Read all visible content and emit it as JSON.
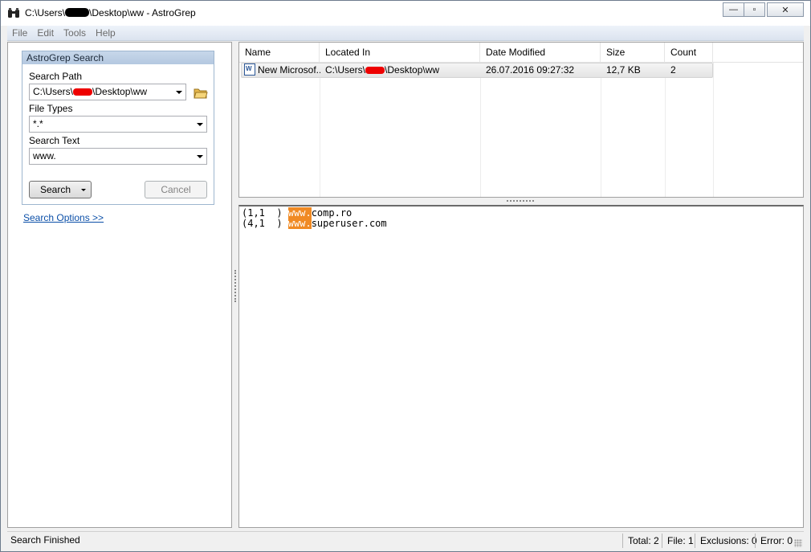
{
  "window": {
    "title_prefix": "C:\\Users\\",
    "title_suffix": "\\Desktop\\ww - AstroGrep",
    "controls": {
      "minimize": "—",
      "maximize": "▫",
      "close": "✕"
    }
  },
  "menu": [
    "File",
    "Edit",
    "Tools",
    "Help"
  ],
  "search_panel": {
    "header": "AstroGrep Search",
    "path_label": "Search Path",
    "path_prefix": "C:\\Users\\",
    "path_suffix": "\\Desktop\\ww",
    "types_label": "File Types",
    "types_value": "*.*",
    "text_label": "Search Text",
    "text_value": "www.",
    "search_button": "Search",
    "cancel_button": "Cancel",
    "options_link": "Search Options >>"
  },
  "results": {
    "columns": [
      "Name",
      "Located In",
      "Date Modified",
      "Size",
      "Count"
    ],
    "rows": [
      {
        "icon": "word-doc-icon",
        "name": "New Microsof...",
        "located_prefix": "C:\\Users\\",
        "located_suffix": "\\Desktop\\ww",
        "date": "26.07.2016 09:27:32",
        "size": "12,7 KB",
        "count": "2"
      }
    ]
  },
  "matches": [
    {
      "pos": "(1,1  ) ",
      "match": "www.",
      "rest": "comp.ro"
    },
    {
      "pos": "(4,1  ) ",
      "match": "www.",
      "rest": "superuser.com"
    }
  ],
  "status": {
    "message": "Search Finished",
    "total": "Total: 2",
    "files": "File: 1",
    "exclusions": "Exclusions: 0",
    "errors": "Error: 0"
  },
  "colors": {
    "highlight": "#f08a24",
    "link": "#0b4fa8",
    "group_header": "#b4c8e0"
  }
}
